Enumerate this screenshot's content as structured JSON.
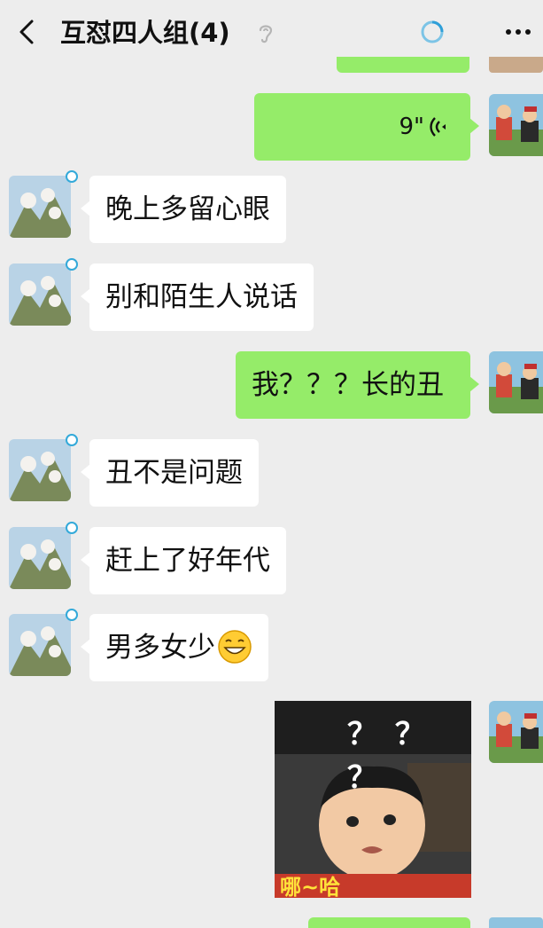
{
  "header": {
    "title": "互怼四人组(4)"
  },
  "icons": {
    "back": "chevron-left-icon",
    "mute": "ear-mute-icon",
    "sync": "sync-ring-icon",
    "more": "more-dots-icon"
  },
  "colors": {
    "background": "#ededed",
    "outgoing_bubble": "#95ec69",
    "incoming_bubble": "#ffffff",
    "online_dot": "#33a9d9"
  },
  "messages": [
    {
      "side": "right",
      "type": "voice",
      "duration": "9\""
    },
    {
      "side": "left",
      "type": "text",
      "text": "晚上多留心眼"
    },
    {
      "side": "left",
      "type": "text",
      "text": "别和陌生人说话"
    },
    {
      "side": "right",
      "type": "text",
      "text": "我？？？长的丑"
    },
    {
      "side": "left",
      "type": "text",
      "text": "丑不是问题"
    },
    {
      "side": "left",
      "type": "text",
      "text": "赶上了好年代"
    },
    {
      "side": "left",
      "type": "text",
      "text": "男多女少",
      "emoji": "grinning-face-emoji"
    },
    {
      "side": "right",
      "type": "sticker",
      "sticker_text": "？ ？ ？",
      "caption": "哪~哈"
    }
  ]
}
